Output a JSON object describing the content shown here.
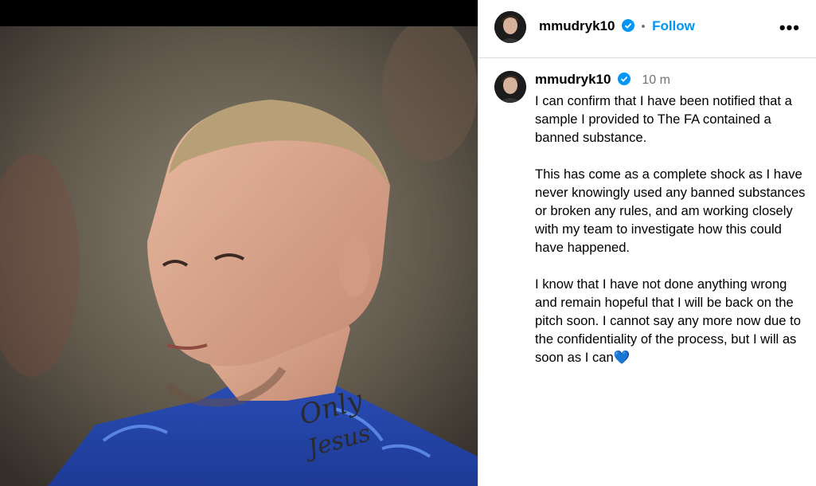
{
  "header": {
    "username": "mmudryk10",
    "separator": "•",
    "follow_label": "Follow",
    "more_label": "•••"
  },
  "post": {
    "username": "mmudryk10",
    "time": "10 m",
    "caption_paragraphs": [
      "I can confirm that I have been notified that a sample I provided to The FA contained a banned substance.",
      "This has come as a complete shock as I have never knowingly used any banned substances or broken any rules, and am working closely with my team to investigate how this could have happened.",
      "I know that I have not done anything wrong and remain hopeful that I will be back on the pitch soon. I cannot say any more now due to the confidentiality of the process, but I will as soon as I can💙"
    ]
  },
  "colors": {
    "accent": "#0095f6",
    "verified": "#0095f6",
    "secondary_text": "#737373",
    "divider": "#dbdbdb"
  },
  "icons": {
    "verified": "verified-badge-icon",
    "more": "more-options-icon",
    "heart": "blue-heart-emoji"
  }
}
